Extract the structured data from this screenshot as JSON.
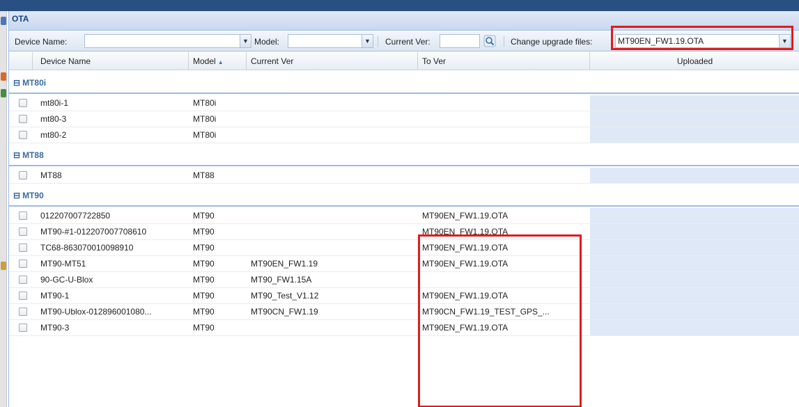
{
  "panel": {
    "title": "OTA"
  },
  "toolbar": {
    "device_name_label": "Device Name:",
    "device_name_value": "",
    "model_label": "Model:",
    "model_value": "",
    "current_ver_label": "Current Ver:",
    "current_ver_value": "",
    "upgrade_label": "Change upgrade files:",
    "upgrade_value": "MT90EN_FW1.19.OTA"
  },
  "grid": {
    "columns": {
      "device_name": "Device Name",
      "model": "Model",
      "current_ver": "Current Ver",
      "to_ver": "To Ver",
      "uploaded": "Uploaded"
    },
    "groups": [
      {
        "label": "MT80i",
        "rows": [
          {
            "device": "mt80i-1",
            "model": "MT80i",
            "current": "",
            "to": ""
          },
          {
            "device": "mt80-3",
            "model": "MT80i",
            "current": "",
            "to": ""
          },
          {
            "device": "mt80-2",
            "model": "MT80i",
            "current": "",
            "to": ""
          }
        ]
      },
      {
        "label": "MT88",
        "rows": [
          {
            "device": "MT88",
            "model": "MT88",
            "current": "",
            "to": ""
          }
        ]
      },
      {
        "label": "MT90",
        "rows": [
          {
            "device": "012207007722850",
            "model": "MT90",
            "current": "",
            "to": "MT90EN_FW1.19.OTA"
          },
          {
            "device": "MT90-#1-012207007708610",
            "model": "MT90",
            "current": "",
            "to": "MT90EN_FW1.19.OTA"
          },
          {
            "device": "TC68-863070010098910",
            "model": "MT90",
            "current": "",
            "to": "MT90EN_FW1.19.OTA"
          },
          {
            "device": "MT90-MT51",
            "model": "MT90",
            "current": "MT90EN_FW1.19",
            "to": "MT90EN_FW1.19.OTA"
          },
          {
            "device": "90-GC-U-Blox",
            "model": "MT90",
            "current": "MT90_FW1.15A",
            "to": ""
          },
          {
            "device": "MT90-1",
            "model": "MT90",
            "current": "MT90_Test_V1.12",
            "to": "MT90EN_FW1.19.OTA"
          },
          {
            "device": "MT90-Ublox-012896001080...",
            "model": "MT90",
            "current": "MT90CN_FW1.19",
            "to": "MT90CN_FW1.19_TEST_GPS_..."
          },
          {
            "device": "MT90-3",
            "model": "MT90",
            "current": "",
            "to": "MT90EN_FW1.19.OTA"
          }
        ]
      }
    ]
  },
  "icons": {
    "dropdown": "chevron-down-icon",
    "search": "magnifier-icon",
    "group_toggle": "collapse-icon",
    "sort": "sort-ascending-icon"
  },
  "colors": {
    "highlight": "#e01b1b",
    "header_text": "#15428b",
    "group_text": "#3b6ba5",
    "uploaded_fill": "#dfe8f6"
  }
}
